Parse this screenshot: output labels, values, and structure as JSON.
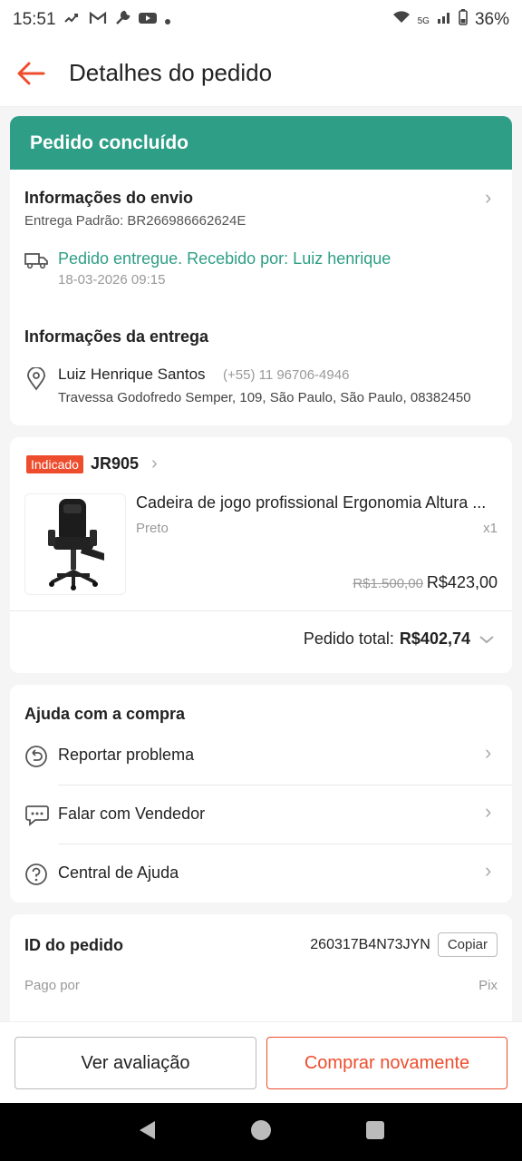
{
  "status_bar": {
    "time": "15:51",
    "notification_icons": [
      "missed-call-icon",
      "gmail-icon",
      "wrench-icon",
      "youtube-icon",
      "dot-icon"
    ],
    "network": "5G",
    "battery": "36%"
  },
  "header": {
    "title": "Detalhes do pedido",
    "accent_color": "#ee4d2d"
  },
  "order_status": {
    "label": "Pedido concluído",
    "color": "#2e9e86"
  },
  "shipping": {
    "title": "Informações do envio",
    "tracking": "Entrega Padrão: BR266986662624E",
    "status": "Pedido entregue. Recebido por: Luiz henrique",
    "timestamp": "18-03-2026 09:15"
  },
  "delivery": {
    "title": "Informações da entrega",
    "name": "Luiz Henrique Santos",
    "phone": "(+55) 11 96706-4946",
    "address": "Travessa Godofredo Semper, 109, São Paulo, São Paulo, 08382450"
  },
  "shop": {
    "badge": "Indicado",
    "name": "JR905"
  },
  "product": {
    "title": "Cadeira de jogo profissional Ergonomia Altura ...",
    "variant": "Preto",
    "quantity": "x1",
    "original_price": "R$1.500,00",
    "price": "R$423,00"
  },
  "total": {
    "label": "Pedido total:",
    "value": "R$402,74"
  },
  "help": {
    "title": "Ajuda com a compra",
    "items": [
      {
        "label": "Reportar problema",
        "icon": "return-icon"
      },
      {
        "label": "Falar com Vendedor",
        "icon": "chat-icon"
      },
      {
        "label": "Central de Ajuda",
        "icon": "help-icon"
      }
    ]
  },
  "order_info": {
    "id_label": "ID do pedido",
    "id_value": "260317B4N73JYN",
    "copy_label": "Copiar",
    "paid_label": "Pago por",
    "paid_value": "Pix"
  },
  "actions": {
    "review": "Ver avaliação",
    "buy_again": "Comprar novamente"
  }
}
